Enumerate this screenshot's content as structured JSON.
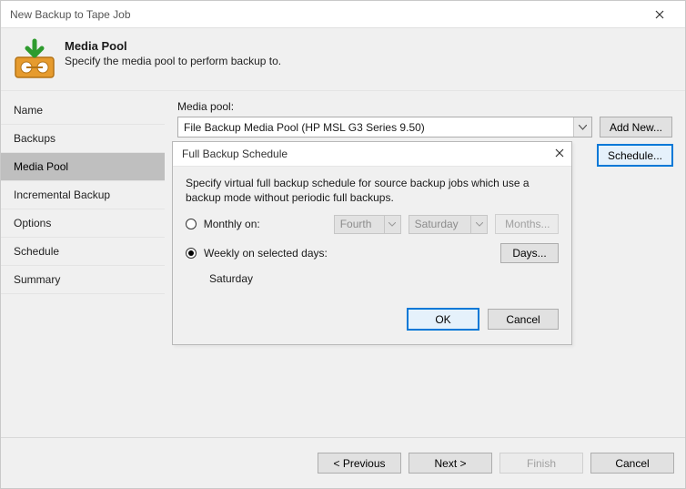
{
  "window": {
    "title": "New Backup to Tape Job"
  },
  "header": {
    "title": "Media Pool",
    "subtitle": "Specify the media pool to perform backup to."
  },
  "sidebar": {
    "items": [
      {
        "label": "Name"
      },
      {
        "label": "Backups"
      },
      {
        "label": "Media Pool"
      },
      {
        "label": "Incremental Backup"
      },
      {
        "label": "Options"
      },
      {
        "label": "Schedule"
      },
      {
        "label": "Summary"
      }
    ],
    "activeIndex": 2
  },
  "content": {
    "mediaPoolLabel": "Media pool:",
    "mediaPoolValue": "File Backup Media Pool (HP MSL G3 Series 9.50)",
    "addNewBtn": "Add New...",
    "scheduleBtn": "Schedule..."
  },
  "dialog": {
    "title": "Full Backup Schedule",
    "description": "Specify virtual full backup schedule for source backup jobs which use a backup mode without periodic full backups.",
    "monthly": {
      "label": "Monthly on:",
      "ordinal": "Fourth",
      "day": "Saturday",
      "monthsBtn": "Months..."
    },
    "weekly": {
      "label": "Weekly on selected days:",
      "daysBtn": "Days...",
      "selectedDays": "Saturday"
    },
    "okBtn": "OK",
    "cancelBtn": "Cancel"
  },
  "footer": {
    "prev": "< Previous",
    "next": "Next >",
    "finish": "Finish",
    "cancel": "Cancel"
  }
}
